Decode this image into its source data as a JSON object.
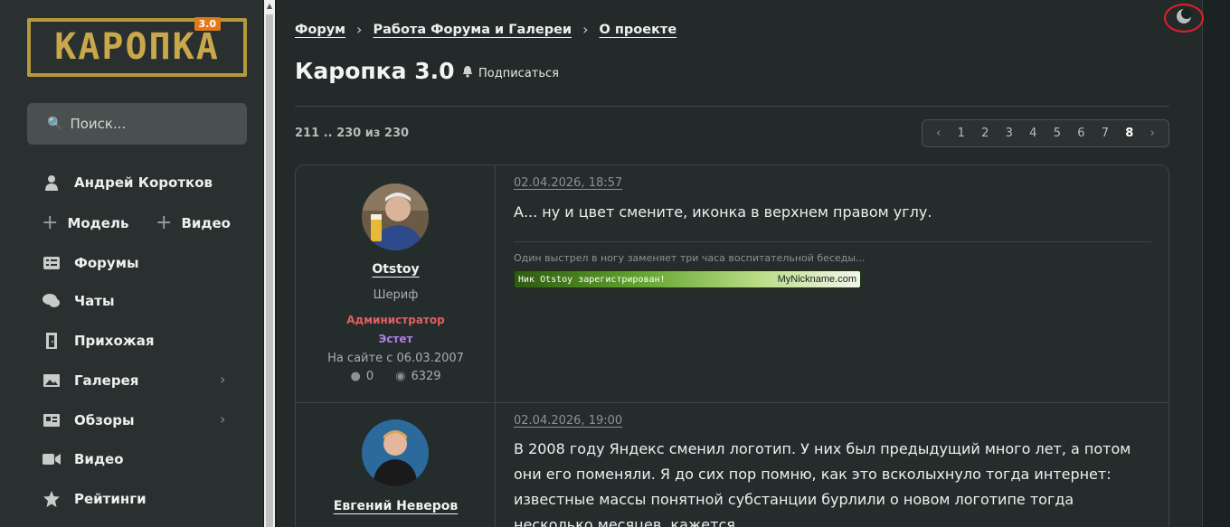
{
  "sidebar": {
    "logo_text": "КАРОПКА",
    "logo_badge": "3.0",
    "search_placeholder": "Поиск...",
    "user_name": "Андрей Коротков",
    "add_model": "Модель",
    "add_video": "Видео",
    "items": [
      {
        "label": "Форумы",
        "icon": "forum-icon"
      },
      {
        "label": "Чаты",
        "icon": "chat-icon"
      },
      {
        "label": "Прихожая",
        "icon": "door-icon"
      },
      {
        "label": "Галерея",
        "icon": "gallery-icon",
        "has_children": true
      },
      {
        "label": "Обзоры",
        "icon": "reviews-icon",
        "has_children": true
      },
      {
        "label": "Видео",
        "icon": "video-icon"
      },
      {
        "label": "Рейтинги",
        "icon": "star-icon"
      }
    ]
  },
  "breadcrumb": [
    "Форум",
    "Работа Форума и Галереи",
    "О проекте"
  ],
  "page": {
    "title": "Каропка 3.0",
    "subscribe_label": "Подписаться",
    "range_text": "211 .. 230 из 230"
  },
  "pager": {
    "prev": "‹",
    "next": "›",
    "pages": [
      "1",
      "2",
      "3",
      "4",
      "5",
      "6",
      "7",
      "8"
    ],
    "current": "8"
  },
  "posts": [
    {
      "author": "Otstoy",
      "rank": "Шериф",
      "role_admin": "Администратор",
      "role_extra": "Эстет",
      "since": "На сайте с 06.03.2007",
      "stat_likes": "0",
      "stat_messages": "6329",
      "date": "02.04.2026, 18:57",
      "text": "А... ну и цвет смените, иконка в верхнем правом углу.",
      "signature": "Один выстрел в ногу заменяет три часа воспитательной беседы...",
      "banner_left": "Ник Otstoy зарегистрирован!",
      "banner_right": "MyNickname.com"
    },
    {
      "author": "Евгений Неверов",
      "date": "02.04.2026, 19:00",
      "text": "В 2008 году Яндекс сменил логотип. У них был предыдущий много лет, а потом они его поменяли. Я до сих пор помню, как это всколыхнуло тогда интернет: известные массы понятной субстанции бурлили о новом логотипе тогда несколько месяцев, кажется."
    }
  ],
  "colors": {
    "background": "#1b2322",
    "sidebar": "#2a302f",
    "logo_gold": "#c8a84a",
    "admin_red": "#e25f5f",
    "esthete_purple": "#b07ee8",
    "toggle_circle": "#e0202a"
  }
}
